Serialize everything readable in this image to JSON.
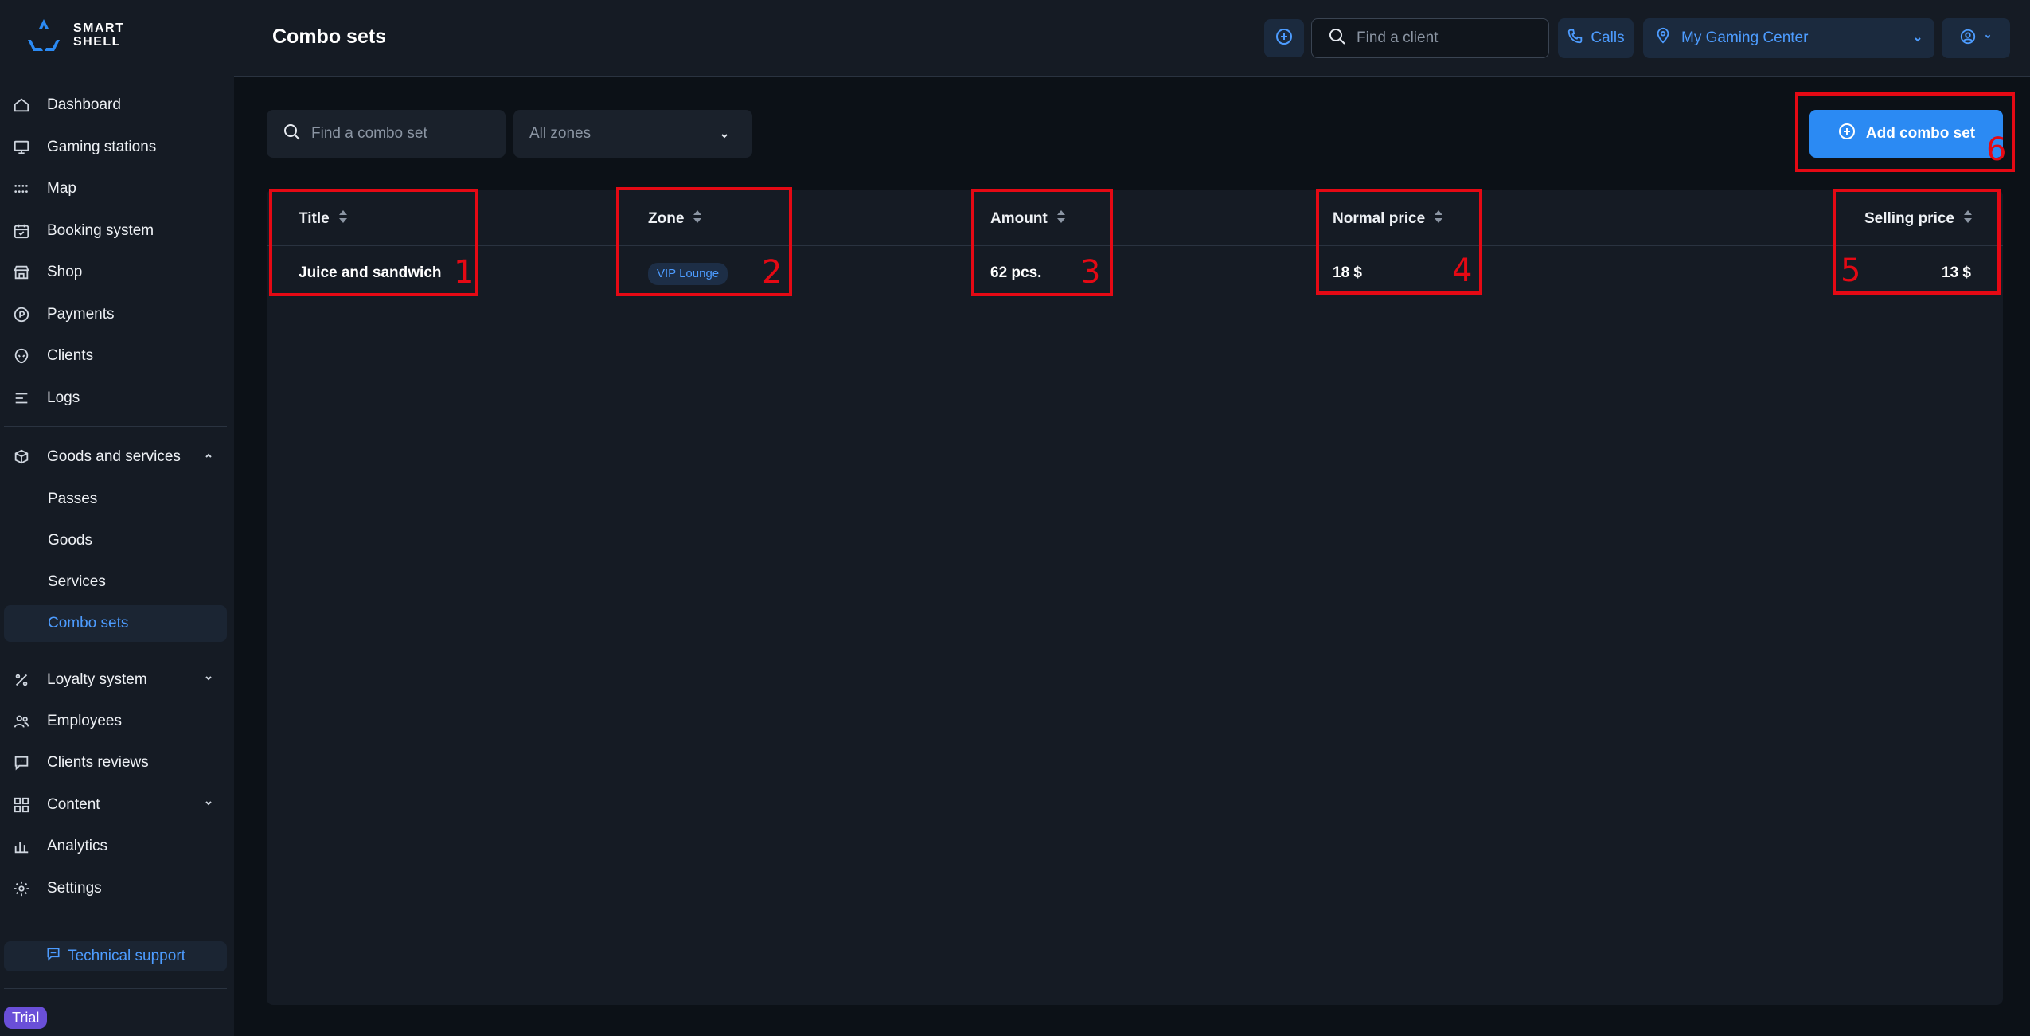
{
  "sidebar": {
    "logo_line1": "SMART",
    "logo_line2": "SHELL",
    "items": [
      {
        "label": "Dashboard",
        "icon": "home-icon"
      },
      {
        "label": "Gaming stations",
        "icon": "monitor-icon"
      },
      {
        "label": "Map",
        "icon": "grid-dots-icon"
      },
      {
        "label": "Booking system",
        "icon": "calendar-icon"
      },
      {
        "label": "Shop",
        "icon": "store-icon"
      },
      {
        "label": "Payments",
        "icon": "coin-icon"
      },
      {
        "label": "Clients",
        "icon": "alien-icon"
      },
      {
        "label": "Logs",
        "icon": "list-icon"
      },
      {
        "label": "Goods and services",
        "icon": "box-icon"
      },
      {
        "label": "Loyalty system",
        "icon": "percent-icon"
      },
      {
        "label": "Employees",
        "icon": "users-icon"
      },
      {
        "label": "Clients reviews",
        "icon": "chat-icon"
      },
      {
        "label": "Content",
        "icon": "layout-icon"
      },
      {
        "label": "Analytics",
        "icon": "bar-chart-icon"
      },
      {
        "label": "Settings",
        "icon": "gear-icon"
      }
    ],
    "sub_items": [
      {
        "label": "Passes"
      },
      {
        "label": "Goods"
      },
      {
        "label": "Services"
      },
      {
        "label": "Combo sets"
      }
    ],
    "support_label": "Technical support",
    "trial_label": "Trial"
  },
  "header": {
    "title": "Combo sets",
    "search_placeholder": "Find a client",
    "calls_label": "Calls",
    "location": "My Gaming Center"
  },
  "filters": {
    "search_placeholder": "Find a combo set",
    "zone_value": "All zones",
    "add_button": "Add combo set"
  },
  "table": {
    "columns": [
      "Title",
      "Zone",
      "Amount",
      "Normal price",
      "Selling price"
    ],
    "rows": [
      {
        "title": "Juice and sandwich",
        "zone": "VIP Lounge",
        "amount": "62 pcs.",
        "normal_price": "18 $",
        "selling_price": "13 $"
      }
    ]
  },
  "annotations": [
    "1",
    "2",
    "3",
    "4",
    "5",
    "6"
  ],
  "colors": {
    "accent": "#2b8af3",
    "link": "#4d9cff",
    "annotation": "#e50914",
    "trial": "#6a4fd8"
  }
}
